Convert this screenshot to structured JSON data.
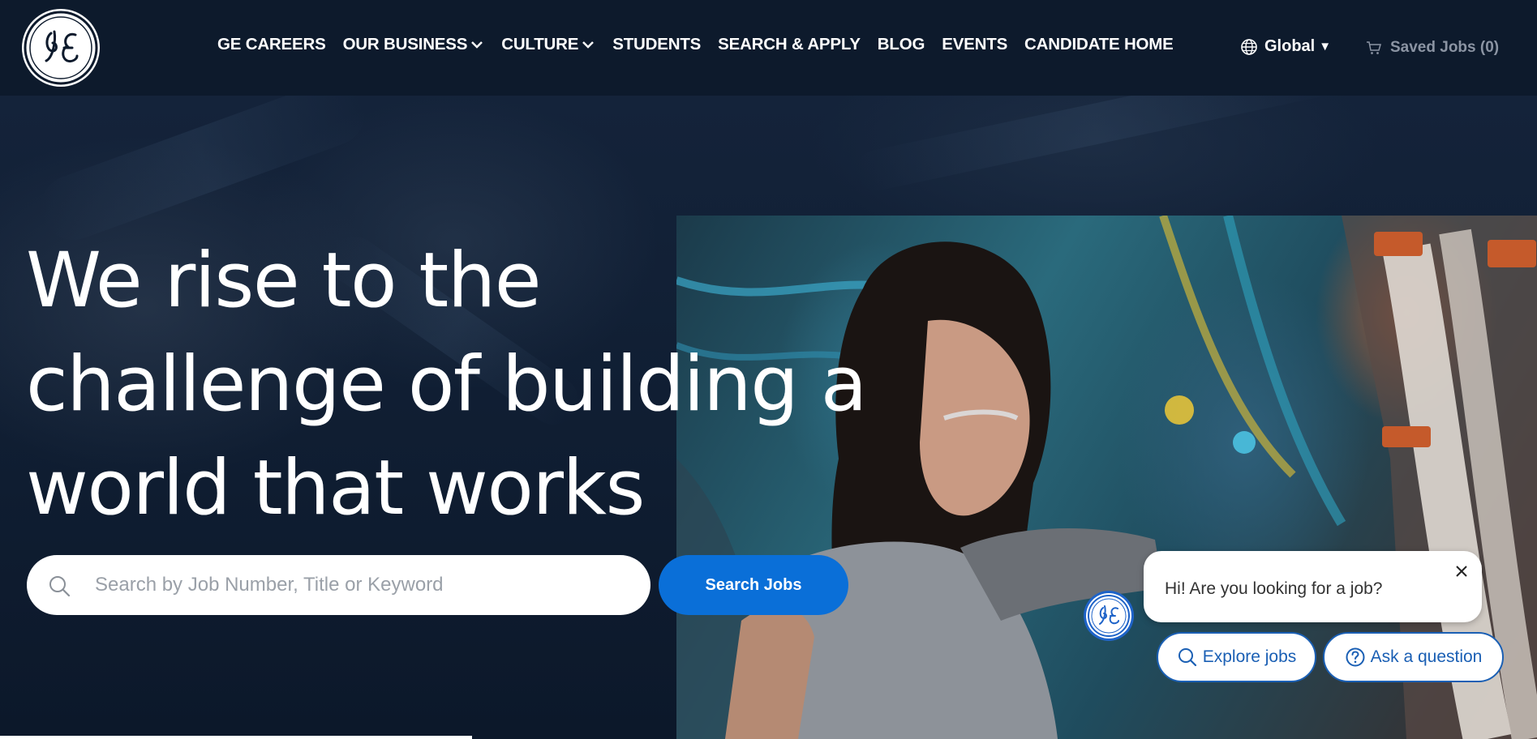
{
  "brand": {
    "logo_text": "GE"
  },
  "nav": {
    "items": [
      {
        "label": "GE CAREERS",
        "has_dropdown": false
      },
      {
        "label": "OUR BUSINESS",
        "has_dropdown": true
      },
      {
        "label": "CULTURE",
        "has_dropdown": true
      },
      {
        "label": "STUDENTS",
        "has_dropdown": false
      },
      {
        "label": "SEARCH & APPLY",
        "has_dropdown": false
      },
      {
        "label": "BLOG",
        "has_dropdown": false
      },
      {
        "label": "EVENTS",
        "has_dropdown": false
      },
      {
        "label": "CANDIDATE HOME",
        "has_dropdown": false
      }
    ],
    "region": {
      "label": "Global",
      "icon": "globe-icon"
    },
    "saved_jobs": {
      "label": "Saved Jobs (0)",
      "icon": "cart-icon"
    }
  },
  "hero": {
    "headline_lines": [
      "We rise to the",
      "challenge of building a",
      "world that works"
    ],
    "search": {
      "placeholder": "Search by Job Number, Title or Keyword",
      "value": "",
      "button_label": "Search Jobs"
    }
  },
  "chat": {
    "message": "Hi! Are you looking for a job?",
    "options": [
      {
        "label": "Explore jobs",
        "icon": "search-icon"
      },
      {
        "label": "Ask a question",
        "icon": "question-icon"
      }
    ]
  },
  "colors": {
    "nav_bg": "#0d1a2c",
    "primary_button": "#0a6fd8",
    "chip_border": "#1a5fb4",
    "saved_jobs_text": "#8b94a3"
  }
}
